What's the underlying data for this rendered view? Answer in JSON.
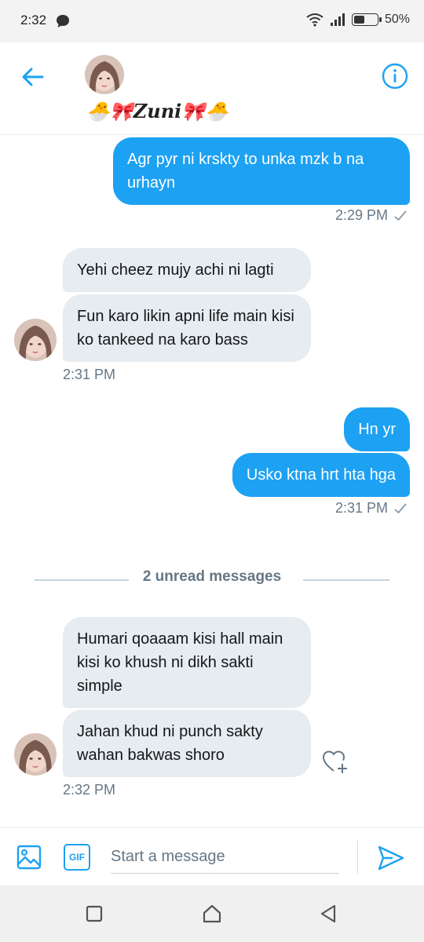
{
  "status_bar": {
    "time": "2:32",
    "battery_percent": "50%",
    "battery_level": 0.5
  },
  "header": {
    "contact_name": "🐣🎀𝒁𝒖𝒏𝒊🎀🐣",
    "icons": {
      "back": "arrow-left-icon",
      "info": "info-icon"
    }
  },
  "messages": [
    {
      "side": "sent",
      "text": "Agr pyr ni krskty to unka mzk b na urhayn"
    },
    {
      "side": "sent_meta",
      "time": "2:29 PM"
    },
    {
      "side": "received",
      "text": "Yehi cheez mujy achi ni lagti"
    },
    {
      "side": "received",
      "text": "Fun karo likin apni life main kisi ko tankeed na karo bass"
    },
    {
      "side": "received_meta",
      "time": "2:31 PM"
    },
    {
      "side": "sent",
      "text": "Hn yr"
    },
    {
      "side": "sent",
      "text": "Usko ktna hrt hta hga"
    },
    {
      "side": "sent_meta",
      "time": "2:31 PM"
    },
    {
      "side": "received",
      "text": "Humari qoaaam kisi hall main kisi ko khush ni dikh sakti simple"
    },
    {
      "side": "received",
      "text": "Jahan khud ni punch sakty wahan bakwas shoro"
    },
    {
      "side": "received_meta",
      "time": "2:32 PM"
    }
  ],
  "unread_divider": "2 unread messages",
  "composer": {
    "placeholder": "Start a message",
    "gif_label": "GIF",
    "icons": {
      "media": "image-icon",
      "send": "send-icon"
    }
  },
  "nav_bar": {
    "icons": [
      "recents-square-icon",
      "home-icon",
      "back-triangle-icon"
    ]
  }
}
